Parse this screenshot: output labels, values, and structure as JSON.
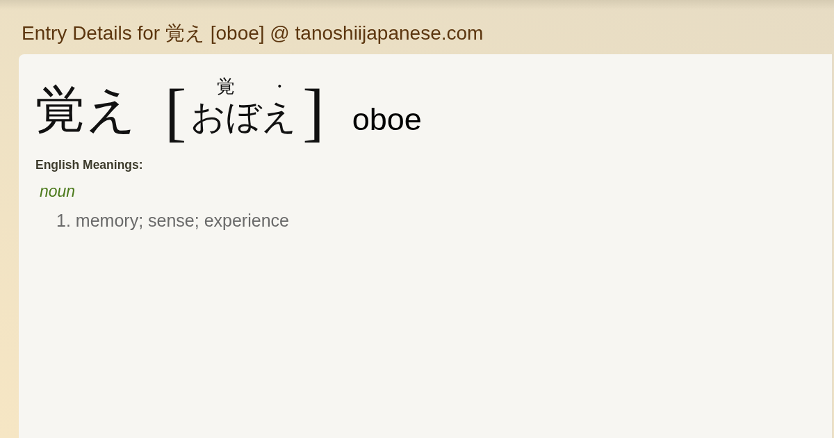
{
  "page_title": "Entry Details for 覚え [oboe] @ tanoshiijapanese.com",
  "entry": {
    "headword": "覚え",
    "brackets": [
      "[",
      "]"
    ],
    "reading": [
      {
        "kana": "おぼ",
        "ruby": "覚"
      },
      {
        "kana": "え",
        "ruby": "・"
      }
    ],
    "romaji": "oboe"
  },
  "meanings": {
    "heading": "English Meanings:",
    "groups": [
      {
        "part_of_speech": "noun",
        "senses": [
          {
            "number": "1.",
            "text": "memory; sense; experience"
          }
        ]
      }
    ]
  }
}
